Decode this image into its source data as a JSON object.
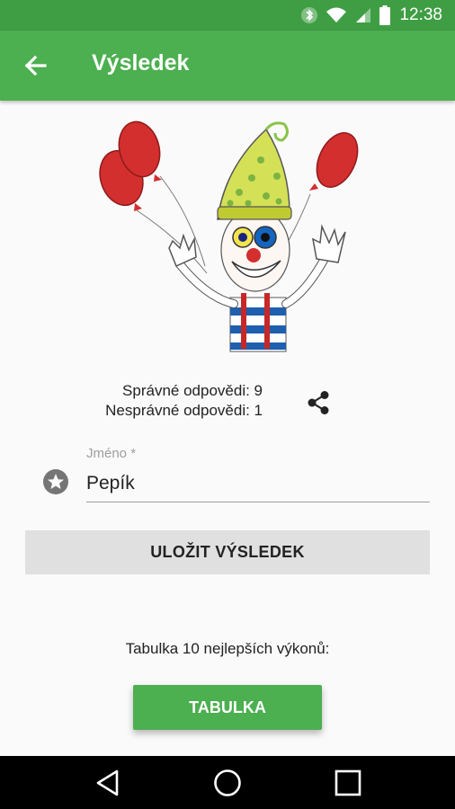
{
  "status_bar": {
    "time": "12:38",
    "icons": [
      "bluetooth-icon",
      "wifi-icon",
      "signal-icon",
      "battery-icon"
    ],
    "color": "#3f9e44"
  },
  "app_bar": {
    "title": "Výsledek",
    "back_icon": "arrow-left-icon",
    "color": "#4caf50"
  },
  "result": {
    "correct": "Správné odpovědi: 9",
    "incorrect": "Nesprávné odpovědi: 1",
    "share_icon": "share-icon"
  },
  "name_field": {
    "label": "Jméno *",
    "value": "Pepík",
    "icon": "star-icon"
  },
  "save_button": {
    "label": "ULOŽIT VÝSLEDEK"
  },
  "leaderboard": {
    "text": "Tabulka 10 nejlepších výkonů:",
    "button_label": "TABULKA"
  },
  "nav_bar": {
    "icons": [
      "back-triangle-icon",
      "home-circle-icon",
      "recents-square-icon"
    ]
  }
}
